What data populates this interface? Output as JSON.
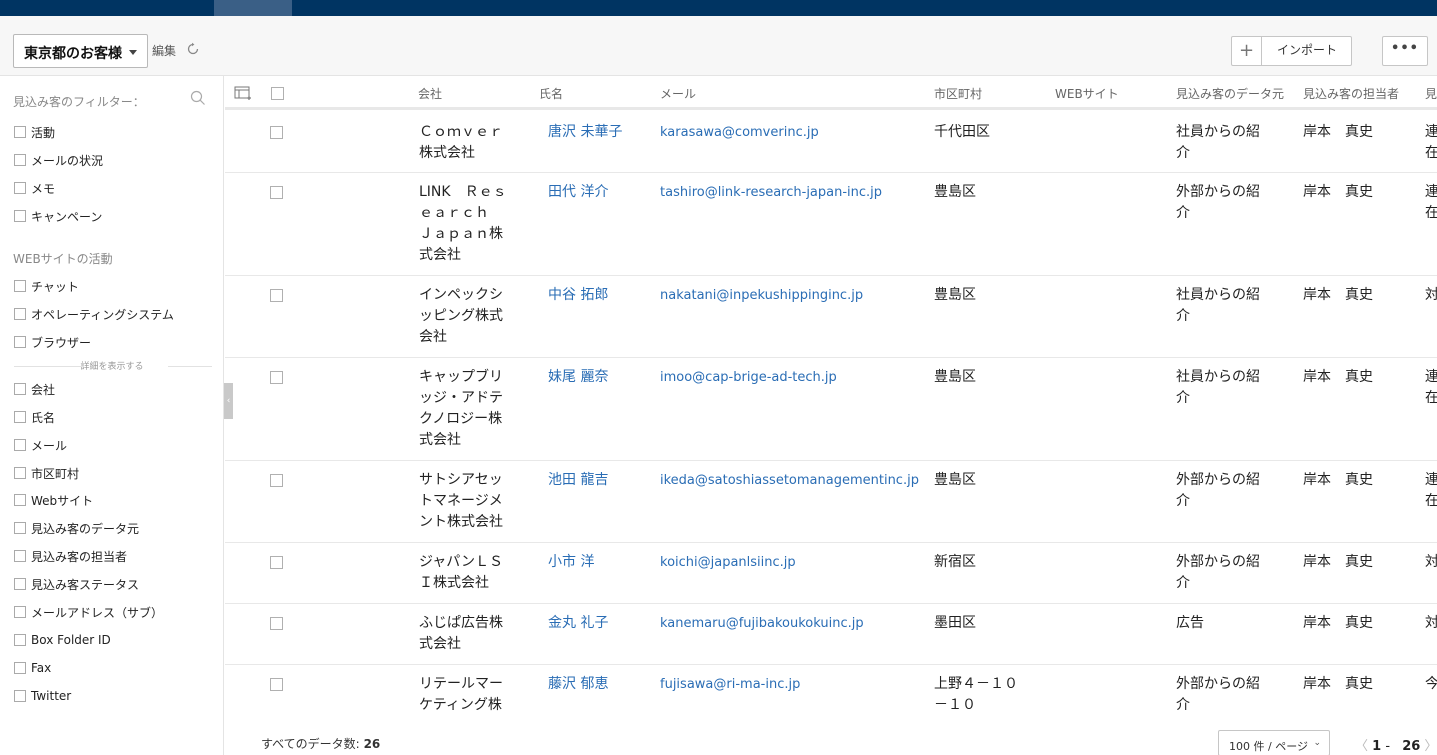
{
  "toolbar": {
    "view_name": "東京都のお客様",
    "edit_label": "編集",
    "add_symbol": "+",
    "import_label": "インポート",
    "more_label": "•••"
  },
  "sidebar": {
    "filter_title": "見込み客のフィルター：",
    "group1": [
      "活動",
      "メールの状況",
      "メモ",
      "キャンペーン"
    ],
    "web_section_title": "WEBサイトの活動",
    "group2": [
      "チャット",
      "オペレーティングシステム",
      "ブラウザー"
    ],
    "show_details_label": "詳細を表示する",
    "group3": [
      "会社",
      "氏名",
      "メール",
      "市区町村",
      "Webサイト",
      "見込み客のデータ元",
      "見込み客の担当者",
      "見込み客ステータス",
      "メールアドレス（サブ）",
      "Box Folder ID",
      "Fax",
      "Twitter"
    ]
  },
  "table": {
    "headers": {
      "company": "会社",
      "name": "氏名",
      "email": "メール",
      "city": "市区町村",
      "website": "WEBサイト",
      "source": "見込み客のデータ元",
      "owner": "見込み客の担当者",
      "status": "見"
    },
    "rows": [
      {
        "company": "Ｃｏｍｖｅｒ株式会社",
        "name": "唐沢 未華子",
        "email": "karasawa@comverinc.jp",
        "city": "千代田区",
        "source": "社員からの紹介",
        "owner": "岸本　真史",
        "status": "連在"
      },
      {
        "company": "LINK　Ｒｅｓｅａｒｃｈ　Ｊａｐａｎ株式会社",
        "name": "田代 洋介",
        "email": "tashiro@link-research-japan-inc.jp",
        "city": "豊島区",
        "source": "外部からの紹介",
        "owner": "岸本　真史",
        "status": "連在"
      },
      {
        "company": "インペックシッピング株式会社",
        "name": "中谷 拓郎",
        "email": "nakatani@inpekushippinginc.jp",
        "city": "豊島区",
        "source": "社員からの紹介",
        "owner": "岸本　真史",
        "status": "対"
      },
      {
        "company": "キャップブリッジ・アドテクノロジー株式会社",
        "name": "妹尾 麗奈",
        "email": "imoo@cap-brige-ad-tech.jp",
        "city": "豊島区",
        "source": "社員からの紹介",
        "owner": "岸本　真史",
        "status": "連在"
      },
      {
        "company": "サトシアセットマネージメント株式会社",
        "name": "池田 龍吉",
        "email": "ikeda@satoshiassetomanagementinc.jp",
        "city": "豊島区",
        "source": "外部からの紹介",
        "owner": "岸本　真史",
        "status": "連在"
      },
      {
        "company": "ジャパンＬＳＩ株式会社",
        "name": "小市 洋",
        "email": "koichi@japanlsiinc.jp",
        "city": "新宿区",
        "source": "外部からの紹介",
        "owner": "岸本　真史",
        "status": "対"
      },
      {
        "company": "ふじぱ広告株式会社",
        "name": "金丸 礼子",
        "email": "kanemaru@fujibakoukokuinc.jp",
        "city": "墨田区",
        "source": "広告",
        "owner": "岸本　真史",
        "status": "対"
      },
      {
        "company": "リテールマーケティング株",
        "name": "藤沢 郁恵",
        "email": "fujisawa@ri-ma-inc.jp",
        "city": "上野４－１０－１０",
        "source": "外部からの紹介",
        "owner": "岸本　真史",
        "status": "今"
      }
    ]
  },
  "footer": {
    "total_label": "すべてのデータ数:",
    "total_count": "26",
    "per_page": "100 件 / ページ",
    "page_range_start": "1",
    "page_range_sep": "-",
    "page_range_end": "26"
  }
}
